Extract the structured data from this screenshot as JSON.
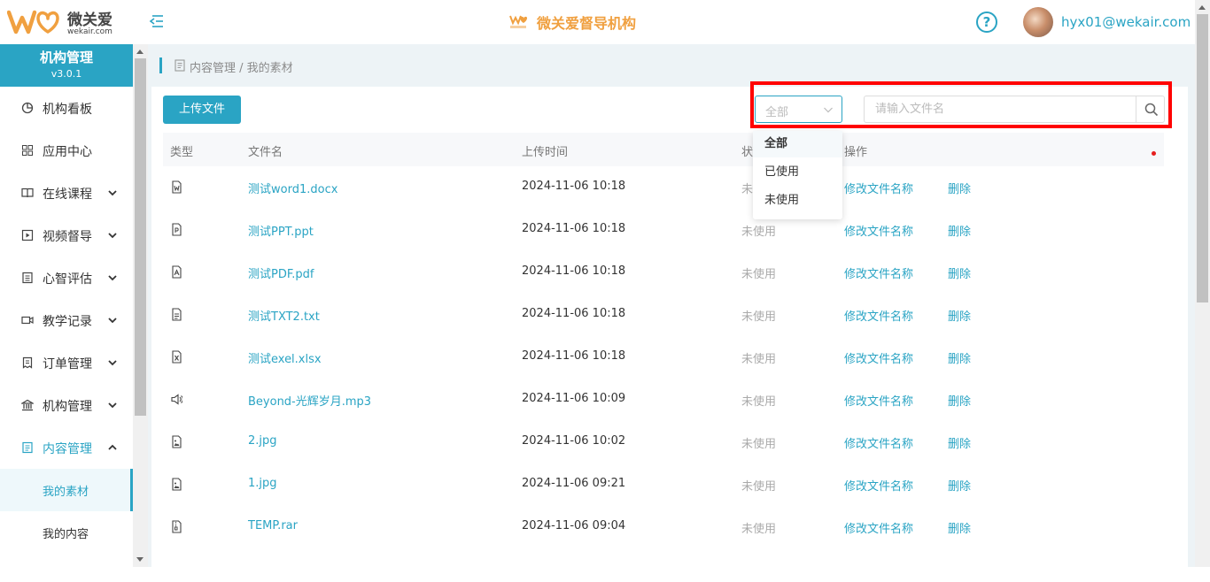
{
  "header": {
    "logo_text": "微关爱",
    "logo_sub": "wekair.com",
    "brand_title": "微关爱督导机构",
    "help_symbol": "?",
    "user_email": "hyx01@wekair.com",
    "accent": "#2aa4c4",
    "brand_color": "#f0a040"
  },
  "sidebar": {
    "title": "机构管理",
    "version": "v3.0.1",
    "items": [
      {
        "label": "机构看板",
        "icon": "pie-chart-icon"
      },
      {
        "label": "应用中心",
        "icon": "grid-icon"
      },
      {
        "label": "在线课程",
        "icon": "book-icon"
      },
      {
        "label": "视频督导",
        "icon": "play-icon"
      },
      {
        "label": "心智评估",
        "icon": "clipboard-icon"
      },
      {
        "label": "教学记录",
        "icon": "video-camera-icon"
      },
      {
        "label": "订单管理",
        "icon": "receipt-icon"
      },
      {
        "label": "机构管理",
        "icon": "building-icon"
      },
      {
        "label": "内容管理",
        "icon": "document-icon"
      }
    ],
    "sub_items": [
      {
        "label": "我的素材"
      },
      {
        "label": "我的内容"
      }
    ]
  },
  "breadcrumb": "内容管理 / 我的素材",
  "toolbar": {
    "upload_label": "上传文件",
    "filter_value": "全部",
    "search_placeholder": "请输入文件名"
  },
  "dropdown": {
    "options": [
      "全部",
      "已使用",
      "未使用"
    ],
    "selected": "全部"
  },
  "table": {
    "headers": {
      "type": "类型",
      "name": "文件名",
      "time": "上传时间",
      "status": "状",
      "ops": "操作"
    },
    "rows": [
      {
        "icon": "word-file-icon",
        "name": "测试word1.docx",
        "time": "2024-11-06 10:18",
        "status": "未使用",
        "rename": "修改文件名称",
        "delete": "删除"
      },
      {
        "icon": "ppt-file-icon",
        "name": "测试PPT.ppt",
        "time": "2024-11-06 10:18",
        "status": "未使用",
        "rename": "修改文件名称",
        "delete": "删除"
      },
      {
        "icon": "pdf-file-icon",
        "name": "测试PDF.pdf",
        "time": "2024-11-06 10:18",
        "status": "未使用",
        "rename": "修改文件名称",
        "delete": "删除"
      },
      {
        "icon": "txt-file-icon",
        "name": "测试TXT2.txt",
        "time": "2024-11-06 10:18",
        "status": "未使用",
        "rename": "修改文件名称",
        "delete": "删除"
      },
      {
        "icon": "excel-file-icon",
        "name": "测试exel.xlsx",
        "time": "2024-11-06 10:18",
        "status": "未使用",
        "rename": "修改文件名称",
        "delete": "删除"
      },
      {
        "icon": "audio-file-icon",
        "name": "Beyond-光辉岁月.mp3",
        "time": "2024-11-06 10:09",
        "status": "未使用",
        "rename": "修改文件名称",
        "delete": "删除"
      },
      {
        "icon": "image-file-icon",
        "name": "2.jpg",
        "time": "2024-11-06 10:02",
        "status": "未使用",
        "rename": "修改文件名称",
        "delete": "删除"
      },
      {
        "icon": "image-file-icon",
        "name": "1.jpg",
        "time": "2024-11-06 09:21",
        "status": "未使用",
        "rename": "修改文件名称",
        "delete": "删除"
      },
      {
        "icon": "archive-file-icon",
        "name": "TEMP.rar",
        "time": "2024-11-06 09:04",
        "status": "未使用",
        "rename": "修改文件名称",
        "delete": "删除"
      }
    ]
  }
}
